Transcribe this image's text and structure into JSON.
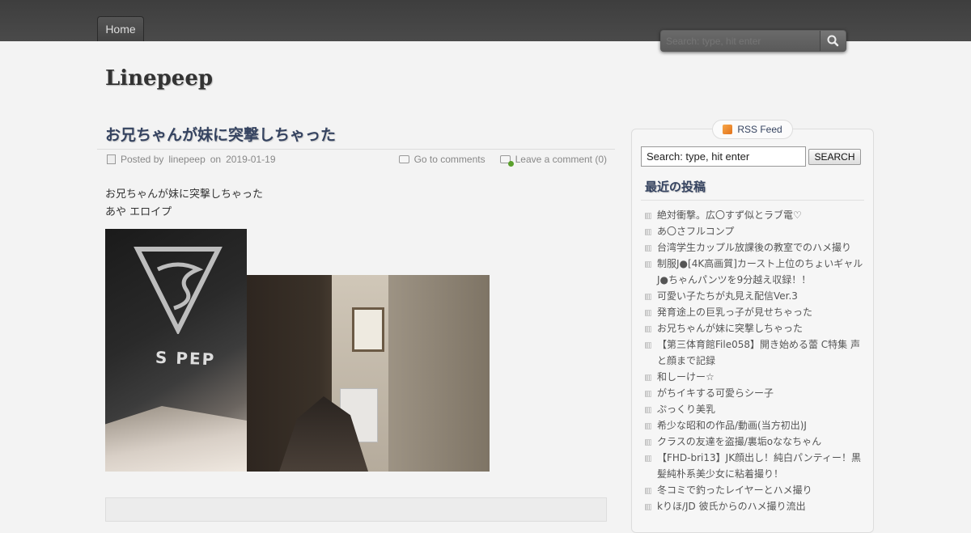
{
  "nav": {
    "home_label": "Home"
  },
  "top_search": {
    "placeholder": "Search: type, hit enter"
  },
  "site": {
    "title": "Linepeep"
  },
  "post": {
    "title": "お兄ちゃんが妹に突撃しちゃった",
    "meta": {
      "posted_by": "Posted by",
      "author": "linepeep",
      "on": "on",
      "date": "2019-01-19",
      "go_to_comments": "Go to comments",
      "leave_comment": "Leave a comment (0)"
    },
    "body_lines": [
      "お兄ちゃんが妹に突撃しちゃった",
      "あや エロイプ"
    ],
    "photo1_text": "S PEP"
  },
  "sidebar": {
    "rss_label": "RSS Feed",
    "search_value": "Search: type, hit enter",
    "search_button": "SEARCH",
    "recent_title": "最近の投稿",
    "recent_posts": [
      "絶対衝撃。広〇すず似とラブ電♡",
      "あ〇さフルコンプ",
      "台湾学生カップル放課後の教室でのハメ撮り",
      "制服J●[4K高画質]カースト上位のちょいギャルJ●ちゃんパンツを9分越え収録！！",
      "可愛い子たちが丸見え配信Ver.3",
      "発育途上の巨乳っ子が見せちゃった",
      "お兄ちゃんが妹に突撃しちゃった",
      "【第三体育館File058】開き始める蕾 C特集 声と顔まで記録",
      "和しーけー☆",
      "がちイキする可愛らシー子",
      "ぷっくり美乳",
      "希少な昭和の作品/動画(当方初出)J",
      "クラスの友達を盗撮/裏垢oななちゃん",
      "【FHD-bri13】JK顔出し！純白パンティー！黒髪純朴系美少女に粘着撮り！",
      "冬コミで釣ったレイヤーとハメ撮り",
      "kりほ/JD 彼氏からのハメ撮り流出"
    ]
  }
}
